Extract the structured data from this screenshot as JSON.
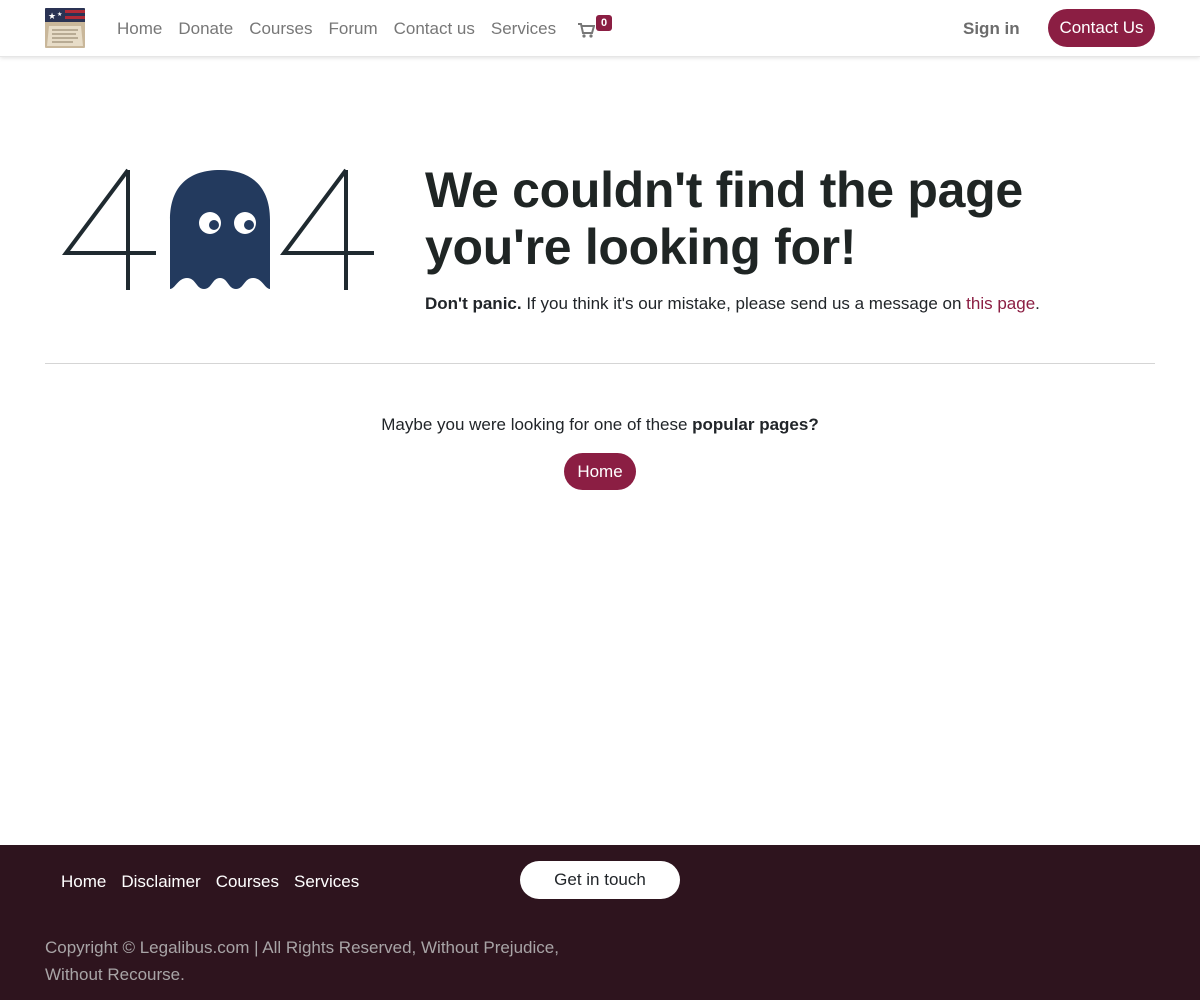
{
  "header": {
    "nav": [
      "Home",
      "Donate",
      "Courses",
      "Forum",
      "Contact us",
      "Services"
    ],
    "cart_count": "0",
    "signin_label": "Sign in",
    "contact_label": "Contact Us"
  },
  "error": {
    "code_left": "4",
    "code_right": "4",
    "headline_line1": "We couldn't find the page",
    "headline_line2": "you're looking for!",
    "lead_bold": "Don't panic.",
    "lead_text": " If you think it's our mistake, please send us a message on ",
    "lead_link": "this page",
    "lead_end": "."
  },
  "popular": {
    "text": "Maybe you were looking for one of these ",
    "bold": "popular pages?",
    "button_label": "Home"
  },
  "footer": {
    "links": [
      "Home",
      "Disclaimer",
      "Courses",
      "Services"
    ],
    "cta_label": "Get in touch",
    "copyright_line1": "Copyright © Legalibus.com | All Rights Reserved, Without Prejudice,",
    "copyright_line2": "Without Recourse."
  },
  "colors": {
    "brand": "#8b1e43",
    "ghost": "#233a5e",
    "footer_bg": "#2e141e"
  },
  "icons": [
    "logo-flag-constitution",
    "cart-icon",
    "ghost-icon"
  ]
}
